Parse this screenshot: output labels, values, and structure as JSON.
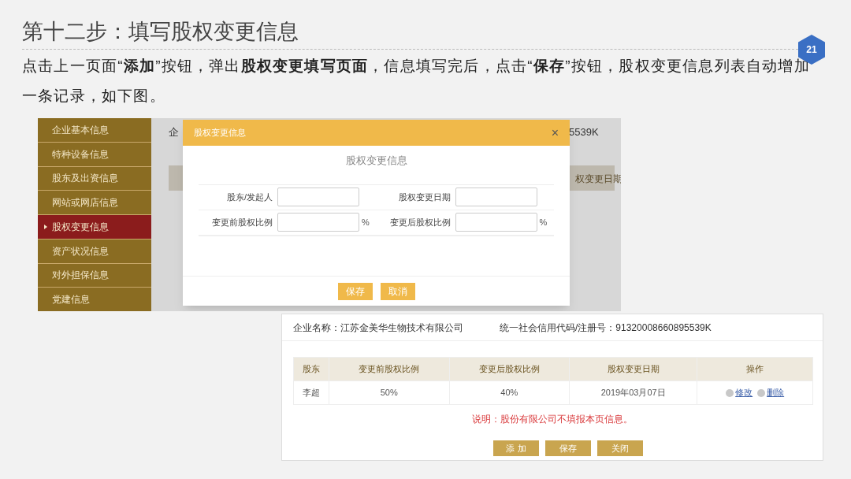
{
  "slide": {
    "title": "第十二步：填写股权变更信息",
    "page_number": "21",
    "description": "点击上一页面“**添加**”按钮，弹出**股权变更填写页面**，信息填写完后，点击“**保存**”按钮，股权变更信息列表自动增加一条记录，如下图。"
  },
  "screenshot_1": {
    "sidebar": [
      {
        "label": "企业基本信息",
        "selected": false
      },
      {
        "label": "特种设备信息",
        "selected": false
      },
      {
        "label": "股东及出资信息",
        "selected": false
      },
      {
        "label": "网站或网店信息",
        "selected": false
      },
      {
        "label": "股权变更信息",
        "selected": true
      },
      {
        "label": "资产状况信息",
        "selected": false
      },
      {
        "label": "对外担保信息",
        "selected": false
      },
      {
        "label": "党建信息",
        "selected": false
      }
    ],
    "background": {
      "company_fragment": "企",
      "code_fragment": "5539K",
      "column_fragment": "权变更日期"
    },
    "dialog": {
      "title": "股权变更信息",
      "close": "×",
      "subtitle": "股权变更信息",
      "fields": [
        {
          "label": "股东/发起人"
        },
        {
          "label": "股权变更日期"
        },
        {
          "label": "变更前股权比例",
          "suffix": "%"
        },
        {
          "label": "变更后股权比例",
          "suffix": "%"
        }
      ],
      "buttons": [
        "保存",
        "取消"
      ]
    }
  },
  "screenshot_2": {
    "company": "企业名称：江苏金美华生物技术有限公司",
    "credit_code": "统一社会信用代码/注册号：91320008660895539K",
    "table": {
      "columns": [
        "股东",
        "变更前股权比例",
        "变更后股权比例",
        "股权变更日期",
        "操作"
      ],
      "rows": [
        {
          "cells": [
            "李超",
            "50%",
            "40%",
            "2019年03月07日"
          ],
          "actions": [
            "修改",
            "删除"
          ]
        }
      ]
    },
    "note": "说明：股份有限公司不填报本页信息。",
    "buttons": [
      "添 加",
      "保存",
      "关闭"
    ]
  }
}
